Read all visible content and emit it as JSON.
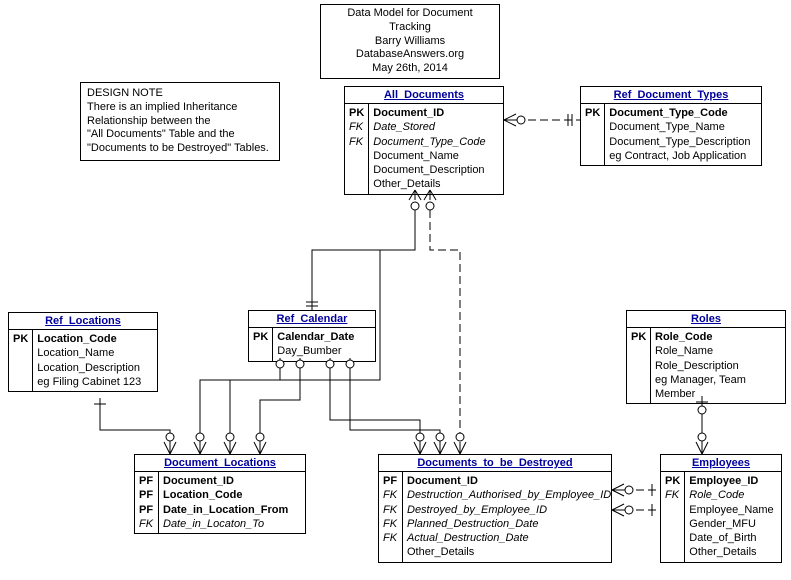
{
  "title": {
    "line1": "Data Model for Document Tracking",
    "line2": "Barry Williams",
    "line3": "DatabaseAnswers.org",
    "line4": "May 26th, 2014"
  },
  "design_note": {
    "heading": "DESIGN NOTE",
    "line1": "There is an implied Inheritance",
    "line2": "Relationship between the",
    "line3": "\"All Documents\" Table and the",
    "line4": "\"Documents to be Destroyed\" Tables."
  },
  "entities": {
    "all_documents": {
      "title": "All_Documents",
      "rows": [
        {
          "key": "PK",
          "attr": "Document_ID",
          "pk": true
        },
        {
          "key": "FK",
          "attr": "Date_Stored",
          "fk": true
        },
        {
          "key": "FK",
          "attr": "Document_Type_Code",
          "fk": true
        },
        {
          "key": "",
          "attr": "Document_Name"
        },
        {
          "key": "",
          "attr": "Document_Description"
        },
        {
          "key": "",
          "attr": "Other_Details"
        }
      ]
    },
    "ref_document_types": {
      "title": "Ref_Document_Types",
      "rows": [
        {
          "key": "PK",
          "attr": "Document_Type_Code",
          "pk": true
        },
        {
          "key": "",
          "attr": "Document_Type_Name"
        },
        {
          "key": "",
          "attr": "Document_Type_Description"
        },
        {
          "key": "",
          "attr": "eg Contract, Job Application"
        }
      ]
    },
    "ref_locations": {
      "title": "Ref_Locations",
      "rows": [
        {
          "key": "PK",
          "attr": "Location_Code",
          "pk": true
        },
        {
          "key": "",
          "attr": "Location_Name"
        },
        {
          "key": "",
          "attr": "Location_Description"
        },
        {
          "key": "",
          "attr": "eg Filing Cabinet 123"
        }
      ]
    },
    "ref_calendar": {
      "title": "Ref_Calendar",
      "rows": [
        {
          "key": "PK",
          "attr": "Calendar_Date",
          "pk": true
        },
        {
          "key": "",
          "attr": "Day_Bumber"
        }
      ]
    },
    "roles": {
      "title": "Roles",
      "rows": [
        {
          "key": "PK",
          "attr": "Role_Code",
          "pk": true
        },
        {
          "key": "",
          "attr": "Role_Name"
        },
        {
          "key": "",
          "attr": "Role_Description"
        },
        {
          "key": "",
          "attr": "eg Manager, Team Member"
        }
      ]
    },
    "document_locations": {
      "title": "Document_Locations",
      "rows": [
        {
          "key": "PF",
          "attr": "Document_ID",
          "pk": true
        },
        {
          "key": "PF",
          "attr": "Location_Code",
          "pk": true
        },
        {
          "key": "PF",
          "attr": "Date_in_Location_From",
          "pk": true
        },
        {
          "key": "FK",
          "attr": "Date_in_Locaton_To",
          "fk": true
        }
      ]
    },
    "documents_to_be_destroyed": {
      "title": "Documents_to_be_Destroyed",
      "rows": [
        {
          "key": "PF",
          "attr": "Document_ID",
          "pk": true
        },
        {
          "key": "FK",
          "attr": "Destruction_Authorised_by_Employee_ID",
          "fk": true
        },
        {
          "key": "FK",
          "attr": "Destroyed_by_Employee_ID",
          "fk": true
        },
        {
          "key": "FK",
          "attr": "Planned_Destruction_Date",
          "fk": true
        },
        {
          "key": "FK",
          "attr": "Actual_Destruction_Date",
          "fk": true
        },
        {
          "key": "",
          "attr": "Other_Details"
        }
      ]
    },
    "employees": {
      "title": "Employees",
      "rows": [
        {
          "key": "PK",
          "attr": "Employee_ID",
          "pk": true
        },
        {
          "key": "FK",
          "attr": "Role_Code",
          "fk": true
        },
        {
          "key": "",
          "attr": "Employee_Name"
        },
        {
          "key": "",
          "attr": "Gender_MFU"
        },
        {
          "key": "",
          "attr": "Date_of_Birth"
        },
        {
          "key": "",
          "attr": "Other_Details"
        }
      ]
    }
  }
}
